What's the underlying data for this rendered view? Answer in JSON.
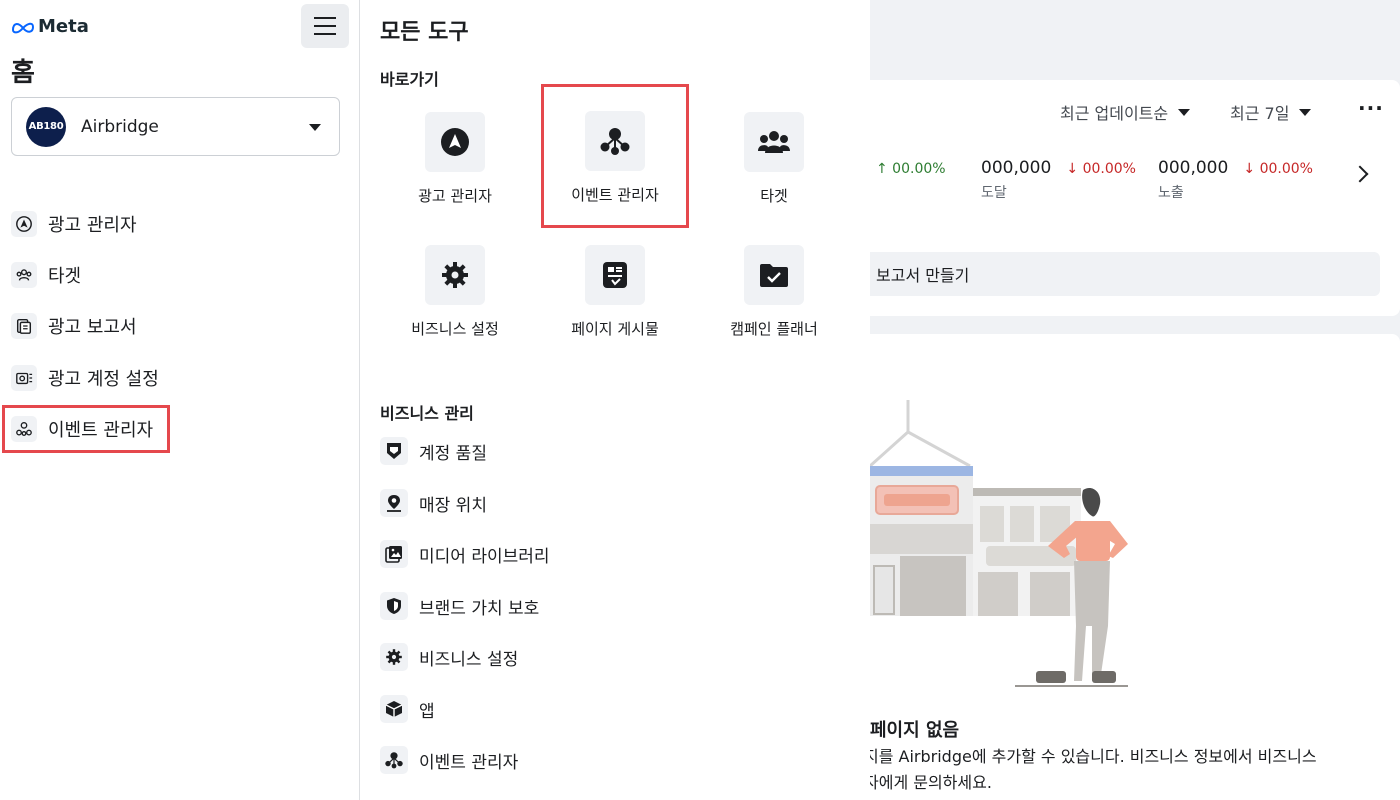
{
  "sidebar": {
    "logo_text": "Meta",
    "home_title": "홈",
    "account": {
      "avatar_text": "AB180",
      "name": "Airbridge"
    },
    "nav": [
      {
        "label": "광고 관리자",
        "icon": "ads-manager-icon"
      },
      {
        "label": "타겟",
        "icon": "audience-icon"
      },
      {
        "label": "광고 보고서",
        "icon": "ad-reports-icon"
      },
      {
        "label": "광고 계정 설정",
        "icon": "ad-account-settings-icon"
      },
      {
        "label": "이벤트 관리자",
        "icon": "events-manager-icon"
      }
    ]
  },
  "tools": {
    "title": "모든 도구",
    "shortcuts_title": "바로가기",
    "shortcuts": [
      {
        "label": "광고 관리자",
        "icon": "ads-manager-icon"
      },
      {
        "label": "이벤트 관리자",
        "icon": "events-manager-icon"
      },
      {
        "label": "타겟",
        "icon": "audience-icon"
      },
      {
        "label": "비즈니스 설정",
        "icon": "gear-icon"
      },
      {
        "label": "페이지 게시물",
        "icon": "page-posts-icon"
      },
      {
        "label": "캠페인 플래너",
        "icon": "campaign-planner-icon"
      }
    ],
    "business_title": "비즈니스 관리",
    "business": [
      {
        "label": "계정 품질",
        "icon": "account-quality-icon"
      },
      {
        "label": "매장 위치",
        "icon": "store-location-icon"
      },
      {
        "label": "미디어 라이브러리",
        "icon": "media-library-icon"
      },
      {
        "label": "브랜드 가치 보호",
        "icon": "brand-safety-icon"
      },
      {
        "label": "비즈니스 설정",
        "icon": "gear-icon"
      },
      {
        "label": "앱",
        "icon": "apps-icon"
      },
      {
        "label": "이벤트 관리자",
        "icon": "events-manager-icon"
      }
    ]
  },
  "content": {
    "filter_sort": "최근 업데이트순",
    "filter_range": "최근 7일",
    "more_label": "···",
    "stats": [
      {
        "value": "",
        "delta": "↑ 00.00%",
        "trend": "up",
        "label": ""
      },
      {
        "value": "000,000",
        "delta": "↓ 00.00%",
        "trend": "down",
        "label": "도달"
      },
      {
        "value": "000,000",
        "delta": "↓ 00.00%",
        "trend": "down",
        "label": "노출"
      }
    ],
    "report_button": "보고서 만들기",
    "no_page_title": "페이지 없음",
    "no_page_desc_line1": "지를 Airbridge에 추가할 수 있습니다. 비즈니스 정보에서 비즈니스",
    "no_page_desc_line2": "자에게 문의하세요."
  },
  "colors": {
    "highlight": "#e5484d",
    "up": "#2e7d32",
    "down": "#c62828",
    "brand": "#0866ff"
  }
}
